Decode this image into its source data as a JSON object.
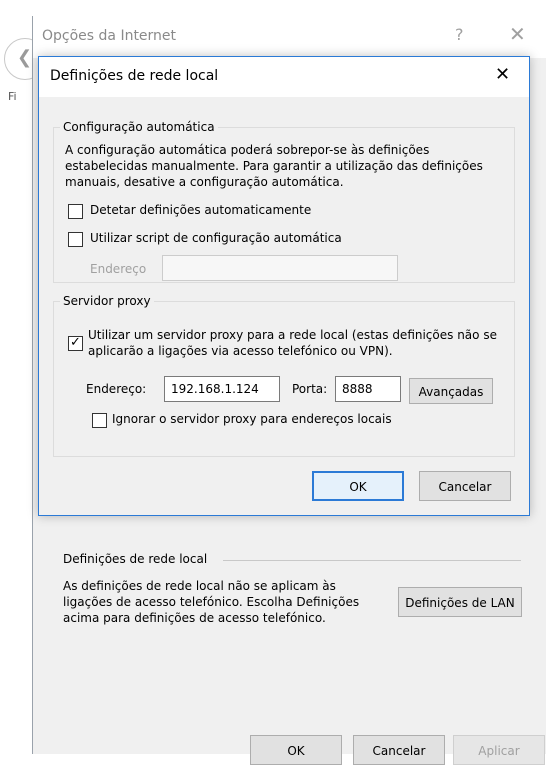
{
  "background": {
    "chevron_glyph": "❮",
    "menu_letter": "Fi"
  },
  "outer_window": {
    "title": "Opções da Internet",
    "help_glyph": "?",
    "lan_section": {
      "legend": "Definições de rede local",
      "description": "As definições de rede local não se aplicam às ligações de acesso telefónico. Escolha Definições acima para definições de acesso telefónico.",
      "button": "Definições de LAN"
    },
    "buttons": {
      "ok": "OK",
      "cancel": "Cancelar",
      "apply": "Aplicar"
    }
  },
  "dialog": {
    "title": "Definições de rede local",
    "auto_config": {
      "legend": "Configuração automática",
      "description": "A configuração automática poderá sobrepor-se às definições estabelecidas manualmente. Para garantir a utilização das definições manuais, desative a configuração automática.",
      "detect_label": "Detetar definições automaticamente",
      "detect_checked": false,
      "script_label": "Utilizar script de configuração automática",
      "script_checked": false,
      "address_label": "Endereço",
      "address_value": ""
    },
    "proxy": {
      "legend": "Servidor proxy",
      "use_proxy_label": "Utilizar um servidor proxy para a rede local (estas definições não se aplicarão a ligações via acesso telefónico ou VPN).",
      "use_proxy_checked": true,
      "address_label": "Endereço:",
      "address_value": "192.168.1.124",
      "port_label": "Porta:",
      "port_value": "8888",
      "advanced_button": "Avançadas",
      "bypass_label": "Ignorar o servidor proxy para endereços locais",
      "bypass_checked": false
    },
    "buttons": {
      "ok": "OK",
      "cancel": "Cancelar"
    }
  },
  "colors": {
    "accent": "#2b7ad6",
    "window_bg": "#f0f0f0"
  }
}
